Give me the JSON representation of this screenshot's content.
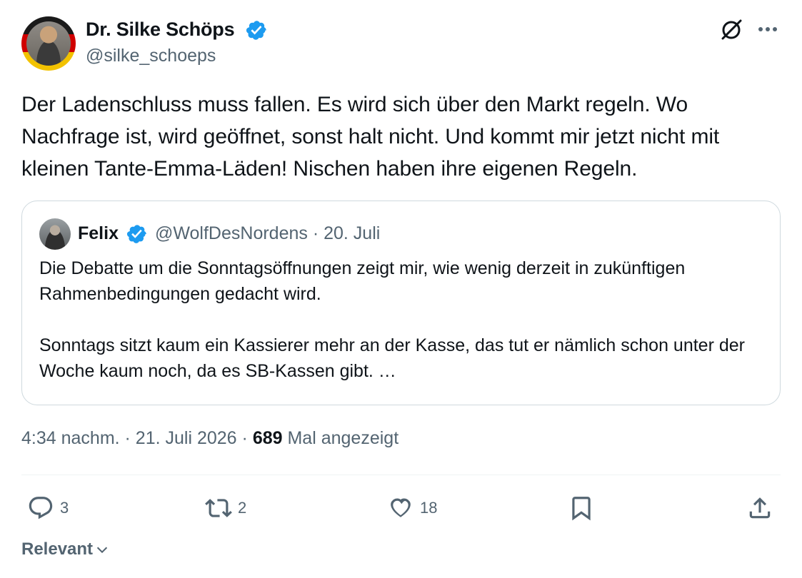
{
  "author": {
    "name": "Dr. Silke Schöps",
    "handle": "@silke_schoeps"
  },
  "tweet_text": "Der Ladenschluss muss fallen. Es wird sich über den Markt regeln. Wo Nachfrage ist, wird geöffnet, sonst halt nicht. Und kommt mir jetzt nicht mit kleinen Tante-Emma-Läden! Nischen haben ihre eigenen Regeln.",
  "quote": {
    "name": "Felix",
    "handle": "@WolfDesNordens",
    "date": "20. Juli",
    "meta": "@WolfDesNordens · 20. Juli",
    "paragraph1": "Die Debatte um die Sonntagsöffnungen zeigt mir, wie wenig derzeit in zukünftigen Rahmenbedingungen gedacht wird.",
    "paragraph2": "Sonntags sitzt kaum ein Kassierer mehr an der Kasse, das tut er nämlich schon unter der Woche kaum noch, da es SB-Kassen gibt. …"
  },
  "timestamp": "4:34 nachm. · 21. Juli 2026 ·",
  "views": {
    "count": "689",
    "label": "Mal angezeigt"
  },
  "actions": {
    "replies": "3",
    "reposts": "2",
    "likes": "18"
  },
  "sort_label": "Relevant",
  "colors": {
    "verified": "#1d9bf0",
    "secondary_text": "#536471",
    "primary_text": "#0f1419",
    "border": "#cfd9de"
  },
  "icons": [
    "verified-badge-icon",
    "grok-icon",
    "more-icon",
    "reply-icon",
    "repost-icon",
    "like-icon",
    "bookmark-icon",
    "share-icon",
    "chevron-down-icon"
  ]
}
